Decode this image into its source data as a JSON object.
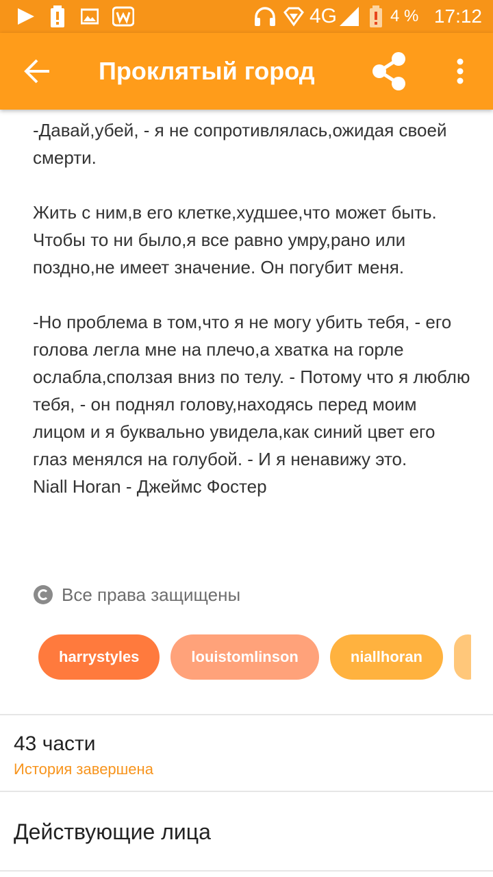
{
  "status_bar": {
    "network": "4G",
    "battery": "4 %",
    "time": "17:12",
    "icons": [
      "play-icon",
      "battery-alert-icon",
      "image-icon",
      "w-app-icon",
      "headset-icon",
      "signal-diamond-icon",
      "signal-bars-icon",
      "battery-low-icon"
    ]
  },
  "app_bar": {
    "title": "Проклятый город",
    "back_icon": "arrow-back-icon",
    "share_icon": "share-icon",
    "more_icon": "more-vert-icon"
  },
  "story": {
    "paragraphs": [
      "-Давай,убей, - я не сопротивлялась,ожидая своей смерти.",
      "Жить с ним,в его клетке,худшее,что может быть. Чтобы то ни было,я все равно умру,рано или поздно,не имеет значение. Он погубит меня.",
      "-Но проблема в том,что я не могу убить тебя, - его голова легла мне на плечо,а хватка на горле ослабла,сползая вниз по телу. - Потому что я люблю тебя, - он поднял голову,находясь перед моим лицом и я буквально увидела,как синий цвет его глаз менялся на голубой. - И я ненавижу это.",
      "Niall Horan - Джеймс Фостер"
    ]
  },
  "copyright": {
    "text": "Все права защищены",
    "icon": "copyright-icon"
  },
  "tags": [
    {
      "label": "harrystyles",
      "color": "#ff7a3d"
    },
    {
      "label": "louistomlinson",
      "color": "#ffa27a"
    },
    {
      "label": "niallhoran",
      "color": "#ffb23f"
    },
    {
      "label": "",
      "color": "#ffc77a"
    }
  ],
  "info": {
    "parts": "43 части",
    "status": "История завершена",
    "characters": "Действующие лица"
  },
  "colors": {
    "accent": "#ff9c1a",
    "status_bar": "#f79418",
    "status_text": "#f7941d"
  }
}
